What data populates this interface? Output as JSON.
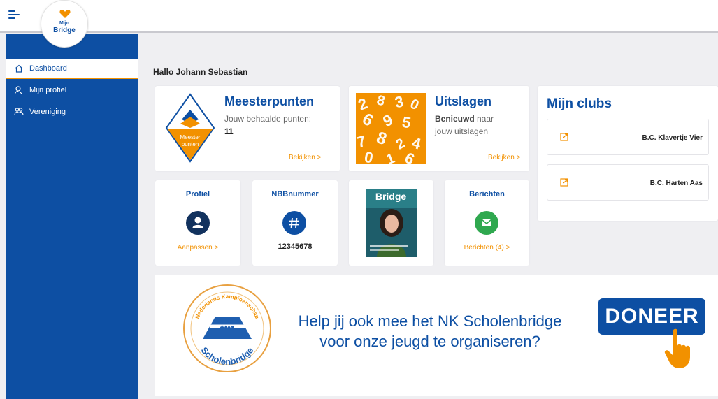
{
  "app": {
    "logo_small": "Mijn",
    "logo_big": "Bridge"
  },
  "sidebar": {
    "items": [
      {
        "label": "Dashboard",
        "icon": "home-icon"
      },
      {
        "label": "Mijn profiel",
        "icon": "user-icon"
      },
      {
        "label": "Vereniging",
        "icon": "users-icon"
      }
    ]
  },
  "greeting": "Hallo Johann Sebastian",
  "meesterpunten": {
    "title": "Meesterpunten",
    "subtitle": "Jouw behaalde punten:",
    "value": "11",
    "link": "Bekijken >",
    "badge_line1": "Meester",
    "badge_line2": "punten"
  },
  "uitslagen": {
    "title": "Uitslagen",
    "sub_bold": "Benieuwd",
    "sub_rest": " naar",
    "sub_line2": "jouw uitslagen",
    "link": "Bekijken >"
  },
  "clubs": {
    "title": "Mijn clubs",
    "items": [
      "B.C. Klavertje Vier",
      "B.C. Harten Aas"
    ]
  },
  "profiel": {
    "title": "Profiel",
    "link": "Aanpassen >"
  },
  "nbb": {
    "title": "NBBnummer",
    "value": "12345678"
  },
  "magazine": {
    "title": "Bridge"
  },
  "berichten": {
    "title": "Berichten",
    "link": "Berichten (4) >"
  },
  "banner": {
    "line1": "Help jij ook mee het NK Scholenbridge",
    "line2": "voor onze jeugd te organiseren?",
    "button": "DONEER",
    "seal_top": "Nederlands Kampioenschap",
    "seal_bottom": "Scholenbridge"
  },
  "colors": {
    "brand_blue": "#0d4fa3",
    "accent_orange": "#f29100",
    "profile_circle": "#12325e",
    "nbb_circle": "#0d4fa3",
    "messages_circle": "#2fa84f"
  }
}
